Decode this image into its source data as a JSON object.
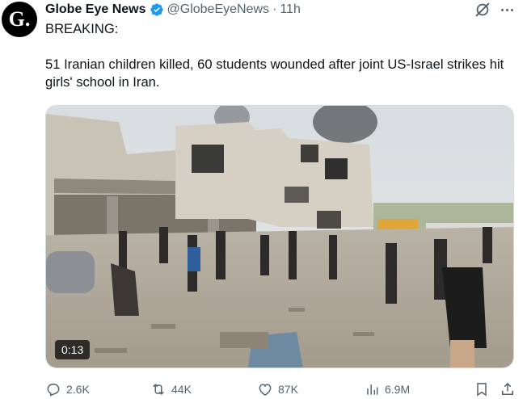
{
  "tweet": {
    "avatar_letter": "G.",
    "author_name": "Globe Eye News",
    "author_handle": "@GlobeEyeNews",
    "separator": "·",
    "time": "11h",
    "text_line1": "BREAKING:",
    "text_line2": "51 Iranian children killed, 60 students wounded after joint US-Israel strikes hit girls' school in Iran.",
    "video_duration": "0:13",
    "verified_color": "#1d9bf0"
  },
  "actions": {
    "replies": "2.6K",
    "reposts": "44K",
    "likes": "87K",
    "views": "6.9M"
  },
  "icons": [
    "verified-badge-icon",
    "grok-icon",
    "more-icon",
    "reply-icon",
    "repost-icon",
    "like-icon",
    "views-icon",
    "bookmark-icon",
    "share-icon"
  ]
}
